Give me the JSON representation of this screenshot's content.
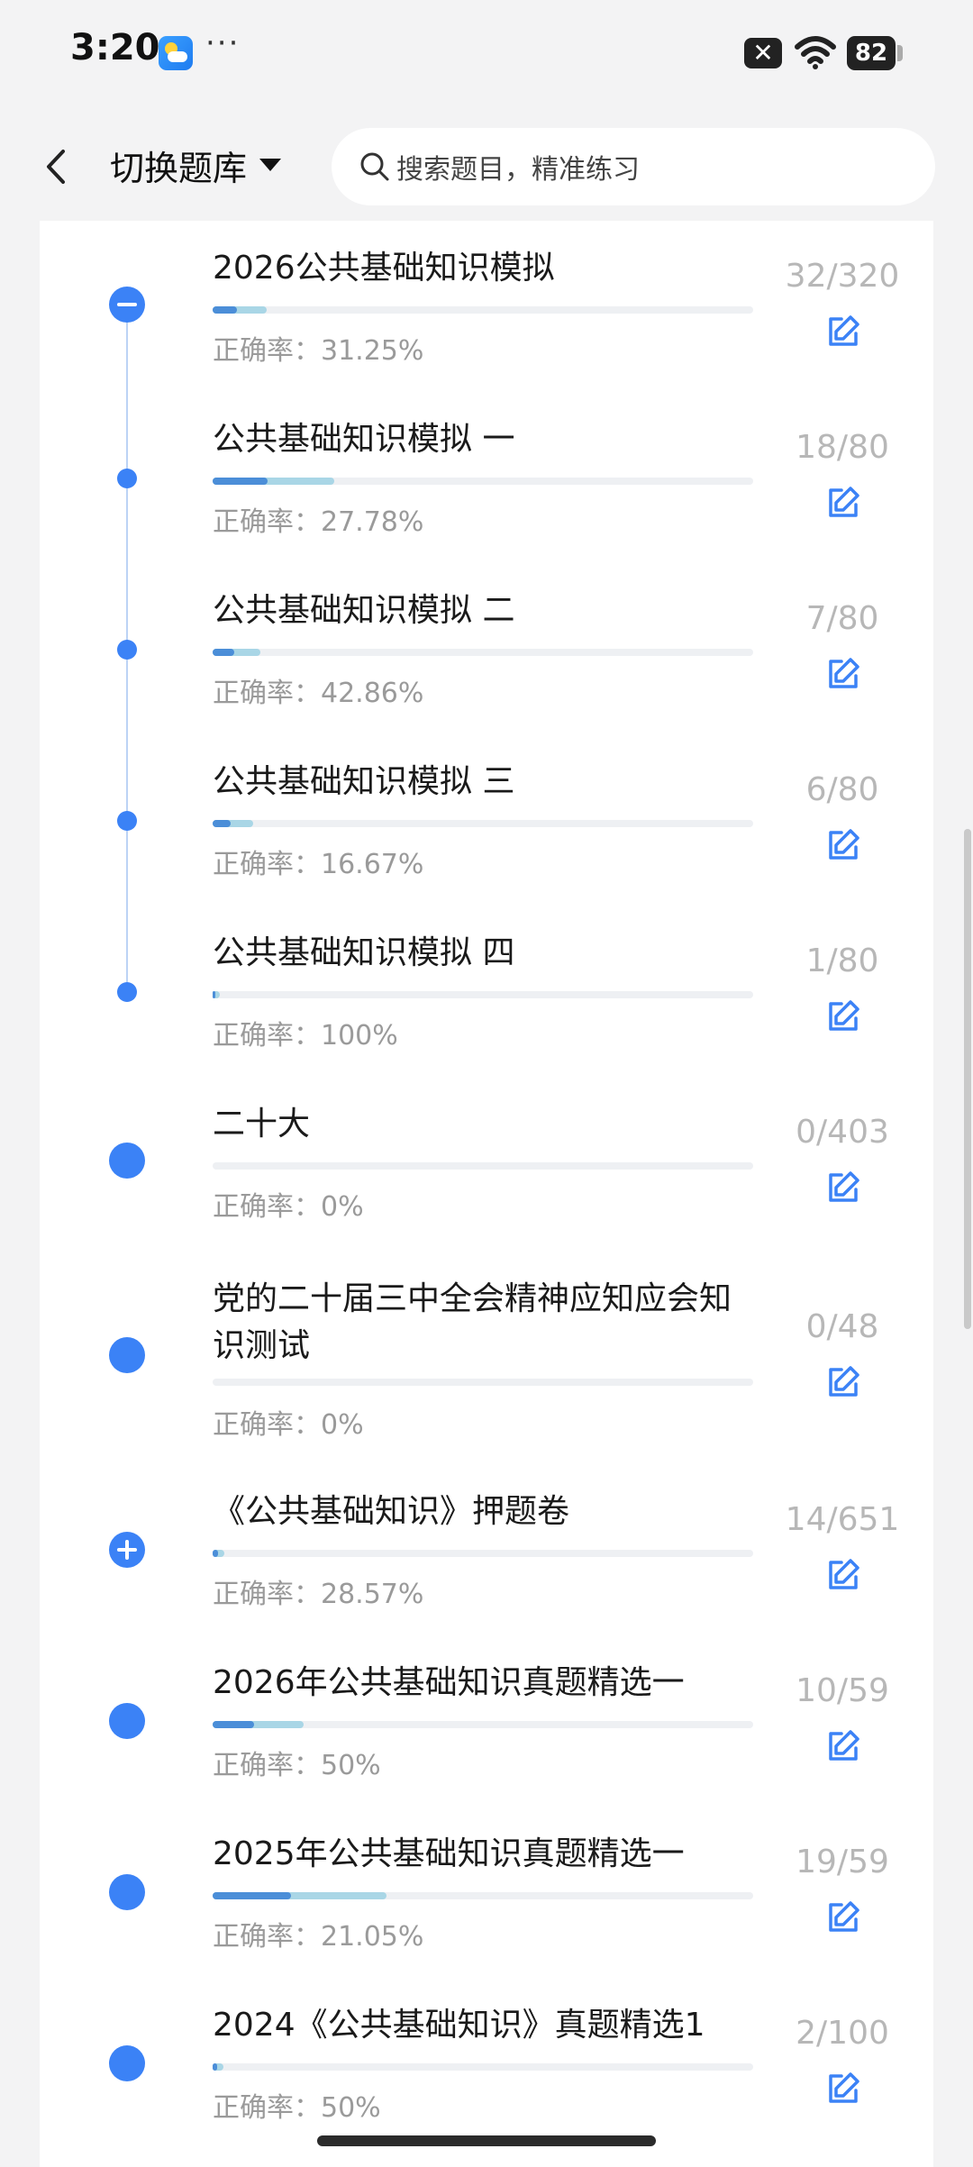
{
  "status": {
    "time": "3:20",
    "more": "···",
    "close_symbol": "✕",
    "battery": "82"
  },
  "nav": {
    "title": "切换题库",
    "search_placeholder": "搜索题目，精准练习"
  },
  "items": [
    {
      "title": "2026公共基础知识模拟",
      "accuracy": "正确率：31.25%",
      "count": "32/320",
      "progress": 0.1,
      "marker": "minus"
    },
    {
      "title": "公共基础知识模拟 一",
      "accuracy": "正确率：27.78%",
      "count": "18/80",
      "progress": 0.225,
      "marker": "small"
    },
    {
      "title": "公共基础知识模拟 二",
      "accuracy": "正确率：42.86%",
      "count": "7/80",
      "progress": 0.0875,
      "marker": "small"
    },
    {
      "title": "公共基础知识模拟 三",
      "accuracy": "正确率：16.67%",
      "count": "6/80",
      "progress": 0.075,
      "marker": "small"
    },
    {
      "title": "公共基础知识模拟 四",
      "accuracy": "正确率：100%",
      "count": "1/80",
      "progress": 0.0125,
      "marker": "small"
    },
    {
      "title": "二十大",
      "accuracy": "正确率：0%",
      "count": "0/403",
      "progress": 0,
      "marker": "large"
    },
    {
      "title": "党的二十届三中全会精神应知应会知识测试",
      "accuracy": "正确率：0%",
      "count": "0/48",
      "progress": 0,
      "marker": "large"
    },
    {
      "title": "《公共基础知识》押题卷",
      "accuracy": "正确率：28.57%",
      "count": "14/651",
      "progress": 0.0215,
      "marker": "plus"
    },
    {
      "title": "2026年公共基础知识真题精选一",
      "accuracy": "正确率：50%",
      "count": "10/59",
      "progress": 0.169,
      "marker": "large"
    },
    {
      "title": "2025年公共基础知识真题精选一",
      "accuracy": "正确率：21.05%",
      "count": "19/59",
      "progress": 0.322,
      "marker": "large"
    },
    {
      "title": "2024《公共基础知识》真题精选1",
      "accuracy": "正确率：50%",
      "count": "2/100",
      "progress": 0.02,
      "marker": "large"
    }
  ],
  "colors": {
    "accent": "#3b82f6",
    "progress_light": "#a9d6e6",
    "progress_dark": "#4b8ed8",
    "muted_text": "#9a9a9a"
  }
}
